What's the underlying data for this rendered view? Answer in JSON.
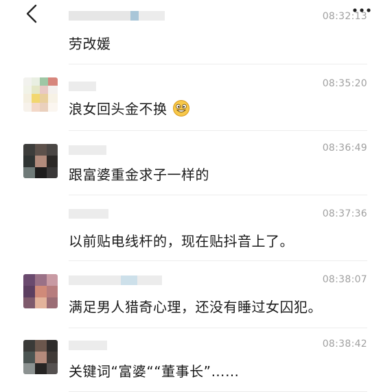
{
  "header": {
    "back_icon": "chevron-left-icon",
    "more_icon": "more-dots-icon"
  },
  "comments": [
    {
      "time": "08:32:13",
      "text": "劳改媛",
      "emoji": ""
    },
    {
      "time": "08:35:20",
      "text": "浪女回头金不换",
      "emoji": "grinning-face-icon"
    },
    {
      "time": "08:36:49",
      "text": "跟富婆重金求子一样的",
      "emoji": ""
    },
    {
      "time": "08:37:36",
      "text": "以前贴电线杆的，现在贴抖音上了。",
      "emoji": ""
    },
    {
      "time": "08:38:07",
      "text": "满足男人猎奇心理，还没有睡过女囚犯。",
      "emoji": ""
    },
    {
      "time": "08:38:42",
      "text": "关键词“富婆““董事长”……",
      "emoji": ""
    }
  ]
}
